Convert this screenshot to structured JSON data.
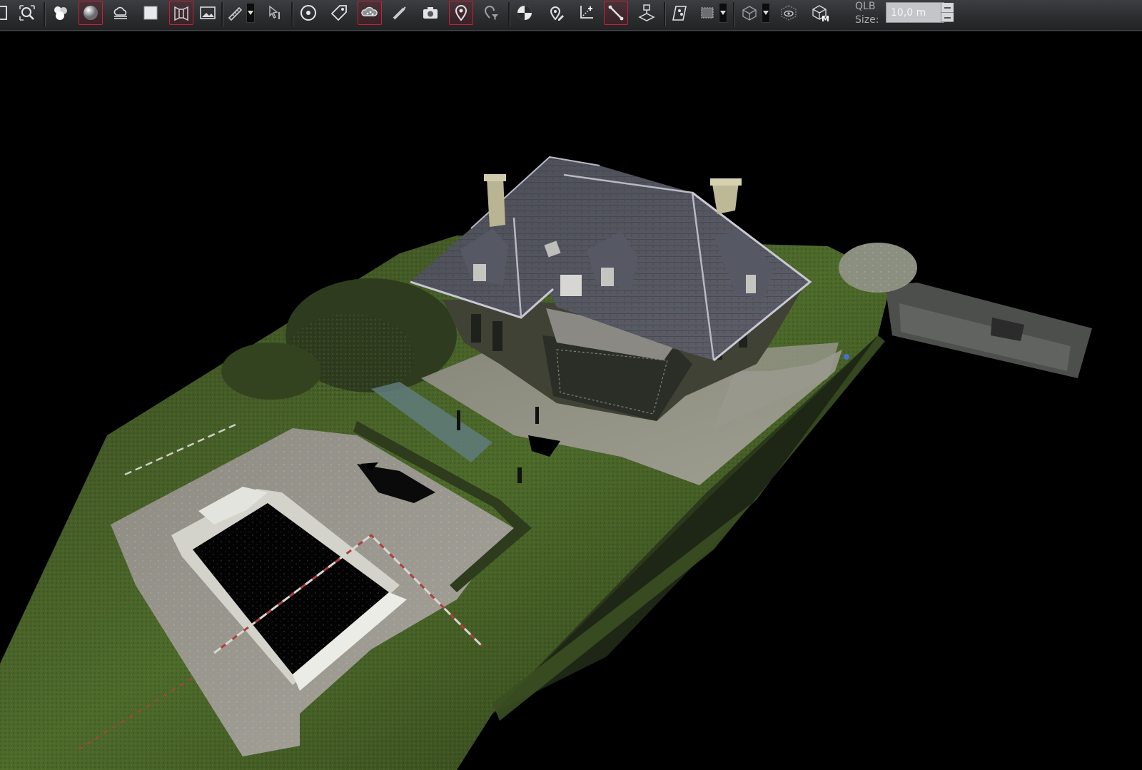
{
  "toolbar": {
    "buttons": [
      {
        "name": "page-icon",
        "active": false
      },
      {
        "name": "zoom-fit-icon",
        "active": false
      },
      {
        "name": "color-circles-icon",
        "active": false
      },
      {
        "name": "shaded-sphere-icon",
        "active": true
      },
      {
        "name": "cloud-layers-icon",
        "active": false
      },
      {
        "name": "white-box-icon",
        "active": false
      },
      {
        "name": "cylinder-projection-icon",
        "active": true
      },
      {
        "name": "image-icon",
        "active": false
      },
      {
        "name": "measure-ruler-icon",
        "active": false
      },
      {
        "name": "cursor-probe-icon",
        "active": false
      },
      {
        "name": "target-icon",
        "active": false
      },
      {
        "name": "tag-icon",
        "active": false
      },
      {
        "name": "cloud-points-icon",
        "active": true
      },
      {
        "name": "pencil-line-icon",
        "active": false
      },
      {
        "name": "camera-icon",
        "active": false
      },
      {
        "name": "location-pin-icon",
        "active": true
      },
      {
        "name": "pin-filter-icon",
        "active": false
      },
      {
        "name": "sphere-target-icon",
        "active": false
      },
      {
        "name": "pin-edit-icon",
        "active": false
      },
      {
        "name": "axes-plus-icon",
        "active": false
      },
      {
        "name": "measure-line-icon",
        "active": true
      },
      {
        "name": "setup-station-icon",
        "active": false
      },
      {
        "name": "map-pins-icon",
        "active": false
      },
      {
        "name": "selection-box-icon",
        "active": false
      },
      {
        "name": "cube-wireframe-icon",
        "active": false
      },
      {
        "name": "cube-eye-icon",
        "active": false
      },
      {
        "name": "cube-model-icon",
        "active": false
      }
    ],
    "qlb_line1": "QLB",
    "qlb_line2": "Size:",
    "size_value": "10,0 m"
  },
  "scene": {
    "name": "point-cloud-3d-view"
  }
}
